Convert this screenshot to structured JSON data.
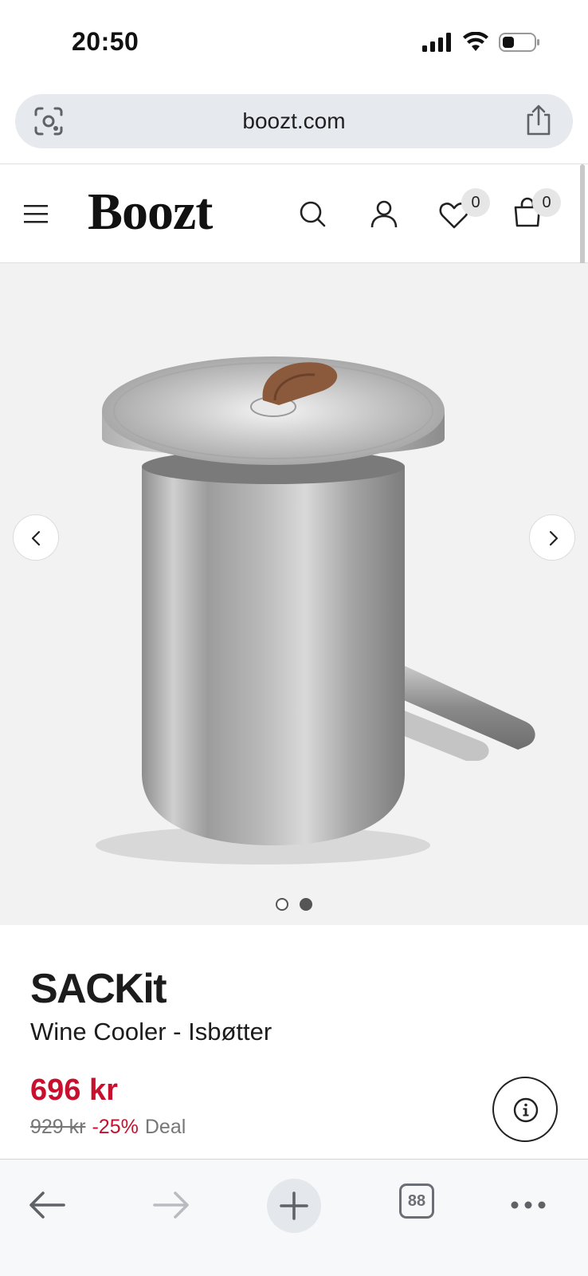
{
  "status_bar": {
    "time": "20:50"
  },
  "url_bar": {
    "url": "boozt.com"
  },
  "header": {
    "logo": "Boozt",
    "wishlist_count": "0",
    "cart_count": "0"
  },
  "gallery": {
    "image_description_icon": "product-photo",
    "dots": 2,
    "active_dot": 2
  },
  "product": {
    "brand": "SACKit",
    "name": "Wine Cooler - Isbøtter",
    "price": "696 kr",
    "old_price": "929 kr",
    "discount": "-25%",
    "deal_label": "Deal"
  },
  "toolbar": {
    "tab_count": "88"
  },
  "colors": {
    "sale_red": "#c8102e",
    "url_bar_bg": "#e6e9ed",
    "gallery_bg": "#f2f2f2"
  }
}
